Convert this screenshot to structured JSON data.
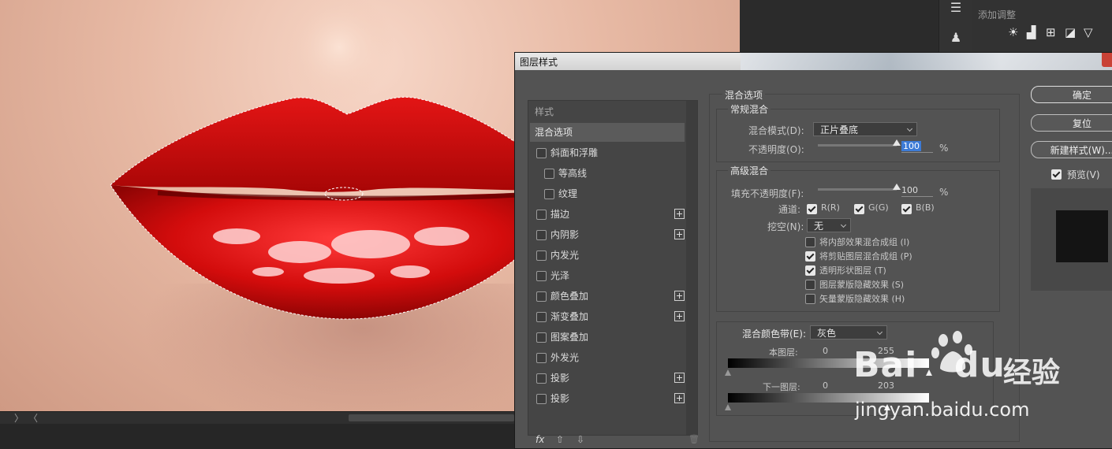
{
  "dialog": {
    "title": "图层样式",
    "list_header": "样式",
    "items": [
      {
        "label": "混合选项",
        "checkbox": false,
        "selected": true,
        "indent": 0,
        "plus": false
      },
      {
        "label": "斜面和浮雕",
        "checkbox": true,
        "checked": false,
        "indent": 0,
        "plus": false
      },
      {
        "label": "等高线",
        "checkbox": true,
        "checked": false,
        "indent": 1,
        "plus": false
      },
      {
        "label": "纹理",
        "checkbox": true,
        "checked": false,
        "indent": 1,
        "plus": false
      },
      {
        "label": "描边",
        "checkbox": true,
        "checked": false,
        "indent": 0,
        "plus": true
      },
      {
        "label": "内阴影",
        "checkbox": true,
        "checked": false,
        "indent": 0,
        "plus": true
      },
      {
        "label": "内发光",
        "checkbox": true,
        "checked": false,
        "indent": 0,
        "plus": false
      },
      {
        "label": "光泽",
        "checkbox": true,
        "checked": false,
        "indent": 0,
        "plus": false
      },
      {
        "label": "颜色叠加",
        "checkbox": true,
        "checked": false,
        "indent": 0,
        "plus": true
      },
      {
        "label": "渐变叠加",
        "checkbox": true,
        "checked": false,
        "indent": 0,
        "plus": true
      },
      {
        "label": "图案叠加",
        "checkbox": true,
        "checked": false,
        "indent": 0,
        "plus": false
      },
      {
        "label": "外发光",
        "checkbox": true,
        "checked": false,
        "indent": 0,
        "plus": false
      },
      {
        "label": "投影",
        "checkbox": true,
        "checked": false,
        "indent": 0,
        "plus": true
      },
      {
        "label": "投影",
        "checkbox": true,
        "checked": false,
        "indent": 0,
        "plus": true
      }
    ],
    "footer": {
      "fx": "fx",
      "up": "⇧",
      "down": "⇩",
      "trash": "🗑"
    },
    "blend": {
      "section_title": "混合选项",
      "general_title": "常规混合",
      "mode_label": "混合模式(D):",
      "mode_value": "正片叠底",
      "opacity_label": "不透明度(O):",
      "opacity_value": "100",
      "opacity_unit": "%",
      "opacity_level": 1.0,
      "advanced_title": "高级混合",
      "fill_label": "填充不透明度(F):",
      "fill_value": "100",
      "fill_unit": "%",
      "fill_level": 1.0,
      "channels_label": "通道:",
      "channels": [
        {
          "label": "R(R)",
          "checked": true
        },
        {
          "label": "G(G)",
          "checked": true
        },
        {
          "label": "B(B)",
          "checked": true
        }
      ],
      "knockout_label": "挖空(N):",
      "knockout_value": "无",
      "options": [
        {
          "label": "将内部效果混合成组 (I)",
          "checked": false
        },
        {
          "label": "将剪贴图层混合成组 (P)",
          "checked": true
        },
        {
          "label": "透明形状图层 (T)",
          "checked": true
        },
        {
          "label": "图层蒙版隐藏效果 (S)",
          "checked": false
        },
        {
          "label": "矢量蒙版隐藏效果 (H)",
          "checked": false
        }
      ],
      "blendif_label": "混合颜色带(E):",
      "blendif_value": "灰色",
      "this_layer_label": "本图层:",
      "this_low": "0",
      "this_high": "255",
      "under_layer_label": "下一图层:",
      "under_low": "0",
      "under_high": "203"
    },
    "buttons": {
      "ok": "确定",
      "reset": "复位",
      "new_style": "新建样式(W)...",
      "preview_label": "预览(V)",
      "preview_checked": true
    }
  },
  "right_panel": {
    "adjust_title": "添加调整",
    "adjust_icons": [
      "☀",
      "▟",
      "⊞",
      "◪",
      "▽"
    ]
  },
  "watermark": {
    "brand": "Bai",
    "brand2": "du",
    "cn": "经验",
    "url": "jingyan.baidu.com"
  },
  "scroll": {
    "left_arrow": "〉",
    "right_arrow": "〈"
  }
}
